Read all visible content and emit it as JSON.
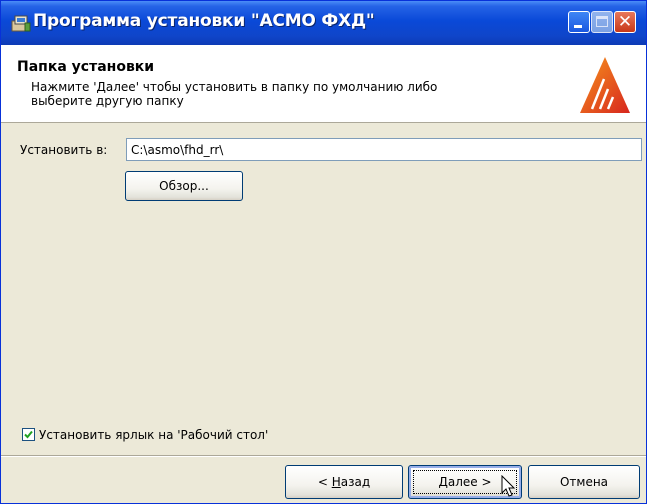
{
  "window": {
    "title": "Программа установки \"АСМО ФХД\"",
    "close_glyph": "✕"
  },
  "header": {
    "title": "Папка установки",
    "description": "Нажмите 'Далее' чтобы установить в папку по умолчанию либо выберите другую папку"
  },
  "install": {
    "label": "Установить в:",
    "path": "C:\\asmo\\fhd_rr\\",
    "browse_label": "Обзор..."
  },
  "shortcut": {
    "checked": true,
    "label": "Установить ярлык на 'Рабочий стол'"
  },
  "buttons": {
    "back_prefix": "< ",
    "back_accel": "Н",
    "back_rest": "азад",
    "next_accel": "Д",
    "next_rest": "алее >",
    "cancel": "Отмена"
  },
  "icons": {
    "app": "installer-icon",
    "logo": "company-logo-icon",
    "cursor": "mouse-pointer-icon"
  },
  "colors": {
    "titlebar": "#0a49d8",
    "background": "#ece9d8",
    "logo_orange": "#f26b21",
    "logo_red": "#d7261e"
  }
}
